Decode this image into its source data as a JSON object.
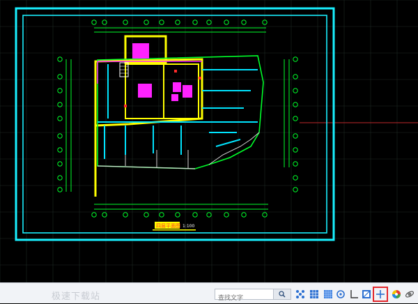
{
  "drawing": {
    "title": "四层平面图",
    "scale": "1:100",
    "colors": {
      "background": "#000000",
      "frame": "#19f0ff",
      "axis": "#00ff2a",
      "wall": "#ffff00",
      "duct": "#00e5ff",
      "equipment": "#ff00ff"
    }
  },
  "statusbar": {
    "watermark": "极速下载站",
    "search_placeholder": "查找文字",
    "tools": [
      {
        "name": "search-icon"
      },
      {
        "name": "snap-icon"
      },
      {
        "name": "grid-icon"
      },
      {
        "name": "ortho-icon"
      },
      {
        "name": "polar-icon"
      },
      {
        "name": "object-snap-icon"
      },
      {
        "name": "layout-icon"
      },
      {
        "name": "ucs-icon"
      },
      {
        "name": "crosshair-icon",
        "active": true
      },
      {
        "name": "color-wheel-icon"
      },
      {
        "name": "orbit-icon"
      }
    ]
  }
}
